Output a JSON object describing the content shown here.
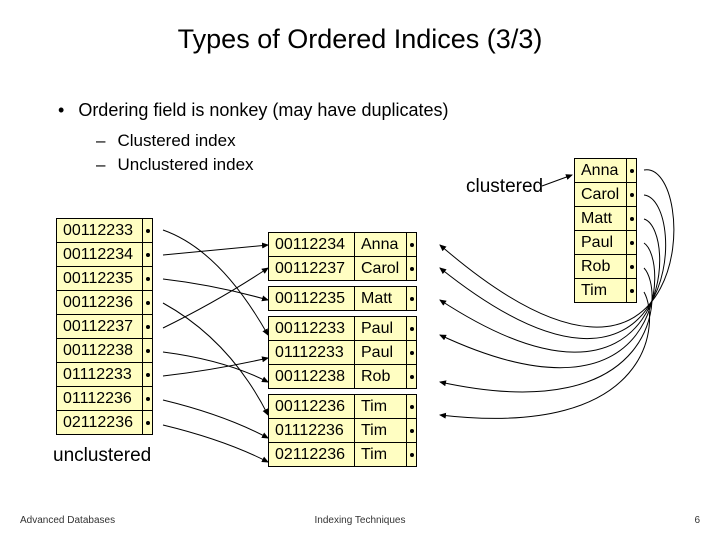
{
  "title": "Types of Ordered Indices (3/3)",
  "bullet1": "Ordering field is nonkey (may have duplicates)",
  "bullet2a": "Clustered index",
  "bullet2b": "Unclustered index",
  "label_clustered": "clustered",
  "label_unclustered": "unclustered",
  "left": [
    "00112233",
    "00112234",
    "00112235",
    "00112236",
    "00112237",
    "00112238",
    "01112233",
    "01112236",
    "02112236"
  ],
  "mid": {
    "g1": [
      {
        "id": "00112234",
        "name": "Anna"
      },
      {
        "id": "00112237",
        "name": "Carol"
      }
    ],
    "g2": [
      {
        "id": "00112235",
        "name": "Matt"
      }
    ],
    "g3": [
      {
        "id": "00112233",
        "name": "Paul"
      },
      {
        "id": "01112233",
        "name": "Paul"
      },
      {
        "id": "00112238",
        "name": "Rob"
      }
    ],
    "g4": [
      {
        "id": "00112236",
        "name": "Tim"
      },
      {
        "id": "01112236",
        "name": "Tim"
      },
      {
        "id": "02112236",
        "name": "Tim"
      }
    ]
  },
  "right": [
    "Anna",
    "Carol",
    "Matt",
    "Paul",
    "Rob",
    "Tim"
  ],
  "footer": {
    "left": "Advanced Databases",
    "mid": "Indexing Techniques",
    "right": "6"
  }
}
